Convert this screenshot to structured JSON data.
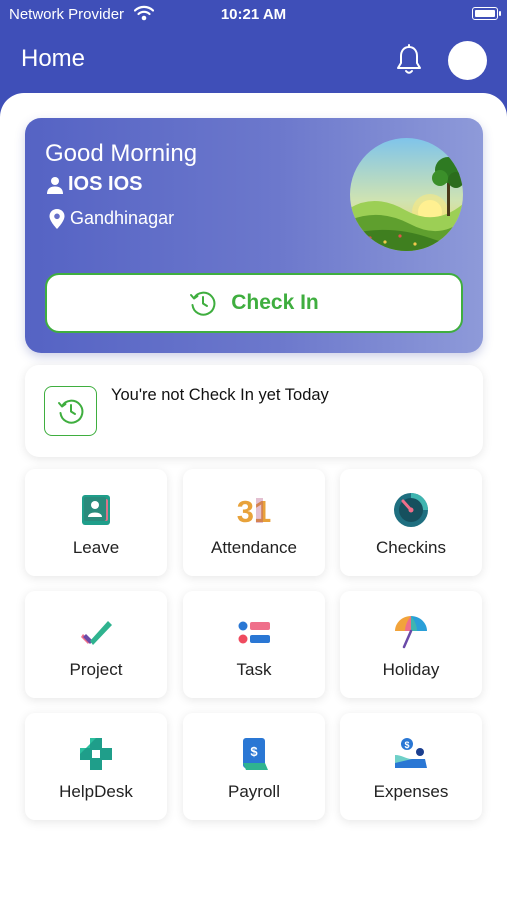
{
  "status_bar": {
    "carrier": "Network Provider",
    "time": "10:21 AM"
  },
  "header": {
    "title": "Home"
  },
  "hero": {
    "greeting": "Good Morning",
    "user_name": "IOS IOS",
    "location": "Gandhinagar",
    "check_in_label": "Check In"
  },
  "notice": {
    "text": "You're not Check In yet Today"
  },
  "tiles": [
    {
      "label": "Leave",
      "icon": "leave-icon"
    },
    {
      "label": "Attendance",
      "icon": "calendar-31-icon"
    },
    {
      "label": "Checkins",
      "icon": "gauge-icon"
    },
    {
      "label": "Project",
      "icon": "project-check-icon"
    },
    {
      "label": "Task",
      "icon": "task-list-icon"
    },
    {
      "label": "Holiday",
      "icon": "umbrella-icon"
    },
    {
      "label": "HelpDesk",
      "icon": "helpdesk-cross-icon"
    },
    {
      "label": "Payroll",
      "icon": "payroll-receipt-icon"
    },
    {
      "label": "Expenses",
      "icon": "expenses-icon"
    }
  ],
  "attendance_icon_text": "31",
  "colors": {
    "primary": "#3f4fb8",
    "success_green": "#3fae3f",
    "teal": "#1f9e8a"
  }
}
